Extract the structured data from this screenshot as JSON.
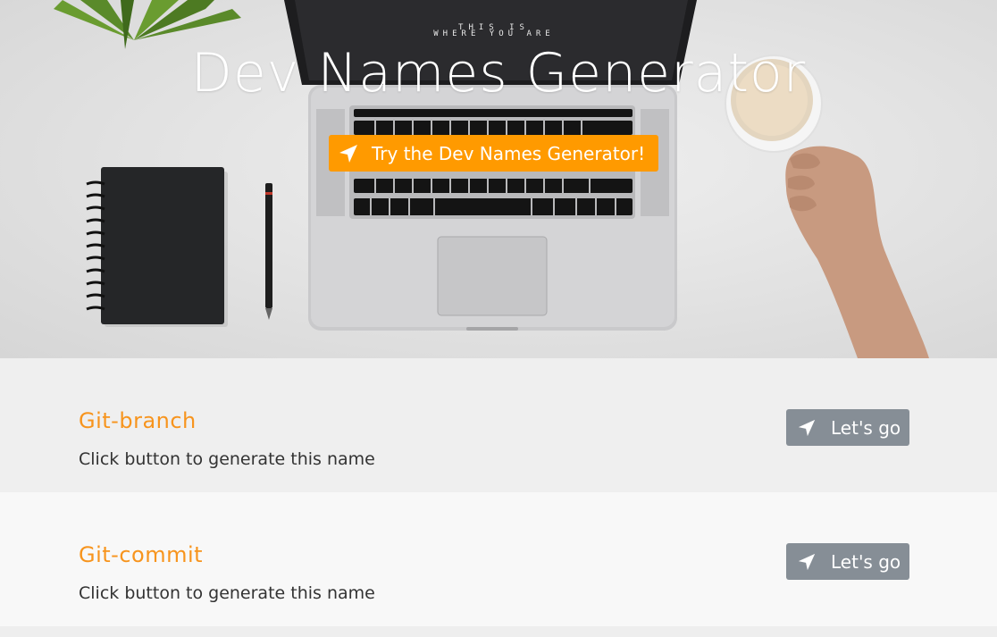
{
  "hero": {
    "title": "Dev Names Generator",
    "cta_label": "Try the Dev Names Generator!",
    "cta_icon": "location-arrow-icon",
    "screen_text_line1": "THIS IS",
    "screen_text_line2": "WHERE YOU ARE"
  },
  "generators": [
    {
      "title": "Git-branch",
      "description": "Click button to generate this name",
      "button_label": "Let's go",
      "button_icon": "location-arrow-icon"
    },
    {
      "title": "Git-commit",
      "description": "Click button to generate this name",
      "button_label": "Let's go",
      "button_icon": "location-arrow-icon"
    }
  ],
  "colors": {
    "accent_orange": "#ff9a00",
    "title_orange": "#f7941d",
    "button_gray": "#868e96",
    "row_dark": "#efefef",
    "row_light": "#f8f8f8"
  }
}
